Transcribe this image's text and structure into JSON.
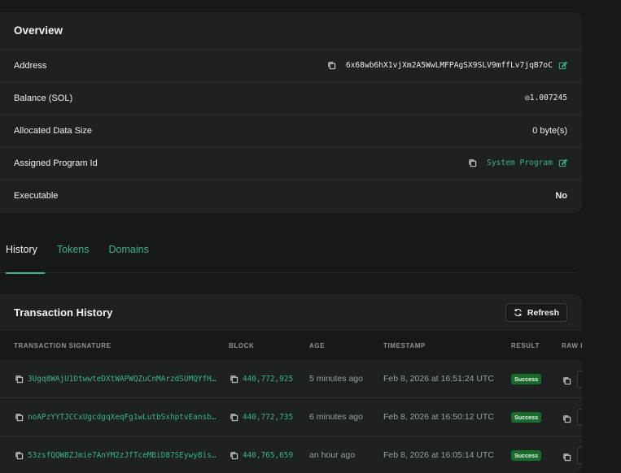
{
  "overview": {
    "title": "Overview",
    "rows": [
      {
        "label": "Address",
        "value": "6x68wb6hX1vjXm2A5WwLMFPAgSX9SLV9mffLv7jqB7oC"
      },
      {
        "label": "Balance (SOL)",
        "value": "◎1.007245"
      },
      {
        "label": "Allocated Data Size",
        "value": "0 byte(s)"
      },
      {
        "label": "Assigned Program Id",
        "value": "System Program"
      },
      {
        "label": "Executable",
        "value": "No"
      }
    ]
  },
  "tabs": [
    {
      "label": "History",
      "active": true
    },
    {
      "label": "Tokens",
      "active": false
    },
    {
      "label": "Domains",
      "active": false
    }
  ],
  "transactions": {
    "title": "Transaction History",
    "refresh_label": "Refresh",
    "columns": [
      "TRANSACTION SIGNATURE",
      "BLOCK",
      "AGE",
      "TIMESTAMP",
      "RESULT",
      "RAW D"
    ],
    "rows": [
      {
        "signature": "3Ugq8WAjU1DtwwteDXtWAPWQZuCnMArzdSUMQYfH…",
        "block": "440,772,925",
        "age": "5 minutes ago",
        "timestamp": "Feb 8, 2026 at 16:51:24 UTC",
        "result": "Success"
      },
      {
        "signature": "noAPzYYTJCCxUgcdgqXeqFg1wLutbSxhptvEansb…",
        "block": "440,772,735",
        "age": "6 minutes ago",
        "timestamp": "Feb 8, 2026 at 16:50:12 UTC",
        "result": "Success"
      },
      {
        "signature": "53zsfQQW8ZJmie7AnYM2zJfTceMBiD87SEywy8is…",
        "block": "440,765,659",
        "age": "an hour ago",
        "timestamp": "Feb 8, 2026 at 16:05:14 UTC",
        "result": "Success"
      }
    ]
  },
  "colors": {
    "accent": "#3fb28a",
    "success_badge": "#1a6b2c",
    "background": "#161918",
    "card": "#1d2120"
  },
  "icons": [
    "copy-icon",
    "edit-icon",
    "refresh-icon"
  ]
}
